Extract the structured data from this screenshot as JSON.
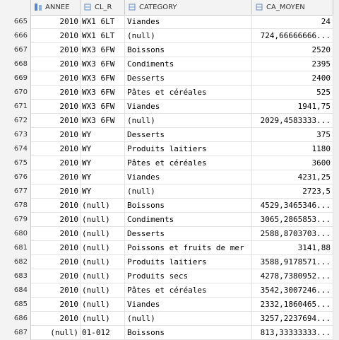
{
  "columns": [
    "ANNEE",
    "CL_R",
    "CATEGORY",
    "CA_MOYEN"
  ],
  "rows": [
    {
      "n": "665",
      "annee": "2010",
      "clr": "WX1 6LT",
      "cat": "Viandes",
      "ca": "24"
    },
    {
      "n": "666",
      "annee": "2010",
      "clr": "WX1 6LT",
      "cat": "(null)",
      "ca": "724,66666666..."
    },
    {
      "n": "667",
      "annee": "2010",
      "clr": "WX3 6FW",
      "cat": "Boissons",
      "ca": "2520"
    },
    {
      "n": "668",
      "annee": "2010",
      "clr": "WX3 6FW",
      "cat": "Condiments",
      "ca": "2395"
    },
    {
      "n": "669",
      "annee": "2010",
      "clr": "WX3 6FW",
      "cat": "Desserts",
      "ca": "2400"
    },
    {
      "n": "670",
      "annee": "2010",
      "clr": "WX3 6FW",
      "cat": "Pâtes et céréales",
      "ca": "525"
    },
    {
      "n": "671",
      "annee": "2010",
      "clr": "WX3 6FW",
      "cat": "Viandes",
      "ca": "1941,75"
    },
    {
      "n": "672",
      "annee": "2010",
      "clr": "WX3 6FW",
      "cat": "(null)",
      "ca": "2029,4583333..."
    },
    {
      "n": "673",
      "annee": "2010",
      "clr": "WY",
      "cat": "Desserts",
      "ca": "375"
    },
    {
      "n": "674",
      "annee": "2010",
      "clr": "WY",
      "cat": "Produits laitiers",
      "ca": "1180"
    },
    {
      "n": "675",
      "annee": "2010",
      "clr": "WY",
      "cat": "Pâtes et céréales",
      "ca": "3600"
    },
    {
      "n": "676",
      "annee": "2010",
      "clr": "WY",
      "cat": "Viandes",
      "ca": "4231,25"
    },
    {
      "n": "677",
      "annee": "2010",
      "clr": "WY",
      "cat": "(null)",
      "ca": "2723,5"
    },
    {
      "n": "678",
      "annee": "2010",
      "clr": "(null)",
      "cat": "Boissons",
      "ca": "4529,3465346..."
    },
    {
      "n": "679",
      "annee": "2010",
      "clr": "(null)",
      "cat": "Condiments",
      "ca": "3065,2865853..."
    },
    {
      "n": "680",
      "annee": "2010",
      "clr": "(null)",
      "cat": "Desserts",
      "ca": "2588,8703703..."
    },
    {
      "n": "681",
      "annee": "2010",
      "clr": "(null)",
      "cat": "Poissons et fruits de mer",
      "ca": "3141,88"
    },
    {
      "n": "682",
      "annee": "2010",
      "clr": "(null)",
      "cat": "Produits laitiers",
      "ca": "3588,9178571..."
    },
    {
      "n": "683",
      "annee": "2010",
      "clr": "(null)",
      "cat": "Produits secs",
      "ca": "4278,7380952..."
    },
    {
      "n": "684",
      "annee": "2010",
      "clr": "(null)",
      "cat": "Pâtes et céréales",
      "ca": "3542,3007246..."
    },
    {
      "n": "685",
      "annee": "2010",
      "clr": "(null)",
      "cat": "Viandes",
      "ca": "2332,1860465..."
    },
    {
      "n": "686",
      "annee": "2010",
      "clr": "(null)",
      "cat": "(null)",
      "ca": "3257,2237694..."
    },
    {
      "n": "687",
      "annee": "(null)",
      "clr": "01-012",
      "cat": "Boissons",
      "ca": "813,33333333..."
    }
  ]
}
